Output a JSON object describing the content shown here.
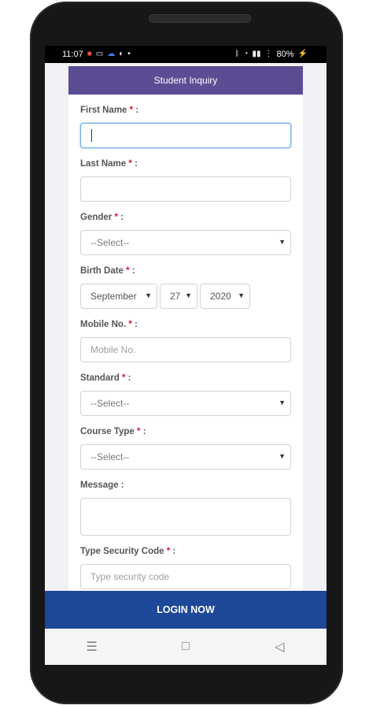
{
  "status": {
    "time": "11:07",
    "battery": "80%",
    "icons_left": [
      "notification-icon",
      "screen-icon",
      "cloud-icon",
      "mask-icon",
      "dot-icon"
    ],
    "icons_right": [
      "bluetooth-icon",
      "alarm-icon",
      "signal-icon",
      "wifi-icon",
      "charging-icon"
    ]
  },
  "header": {
    "title": "Student Inquiry"
  },
  "form": {
    "first_name": {
      "label": "First Name",
      "required": "*",
      "suffix": ":",
      "value": ""
    },
    "last_name": {
      "label": "Last Name",
      "required": "*",
      "suffix": ":",
      "value": ""
    },
    "gender": {
      "label": "Gender",
      "required": "*",
      "suffix": ":",
      "selected": "--Select--"
    },
    "birth_date": {
      "label": "Birth Date",
      "required": "*",
      "suffix": ":",
      "month": "September",
      "day": "27",
      "year": "2020"
    },
    "mobile": {
      "label": "Mobile No.",
      "required": "*",
      "suffix": ":",
      "placeholder": "Mobile No."
    },
    "standard": {
      "label": "Standard",
      "required": "*",
      "suffix": ":",
      "selected": "--Select--"
    },
    "course_type": {
      "label": "Course Type",
      "required": "*",
      "suffix": ":",
      "selected": "--Select--"
    },
    "message": {
      "label": "Message",
      "suffix": ":"
    },
    "security_code": {
      "label": "Type Security Code",
      "required": "*",
      "suffix": ":",
      "placeholder": "Type security code"
    }
  },
  "action": {
    "login_label": "LOGIN NOW"
  },
  "navbar": {
    "recent": "☰",
    "home": "□",
    "back": "◁"
  }
}
